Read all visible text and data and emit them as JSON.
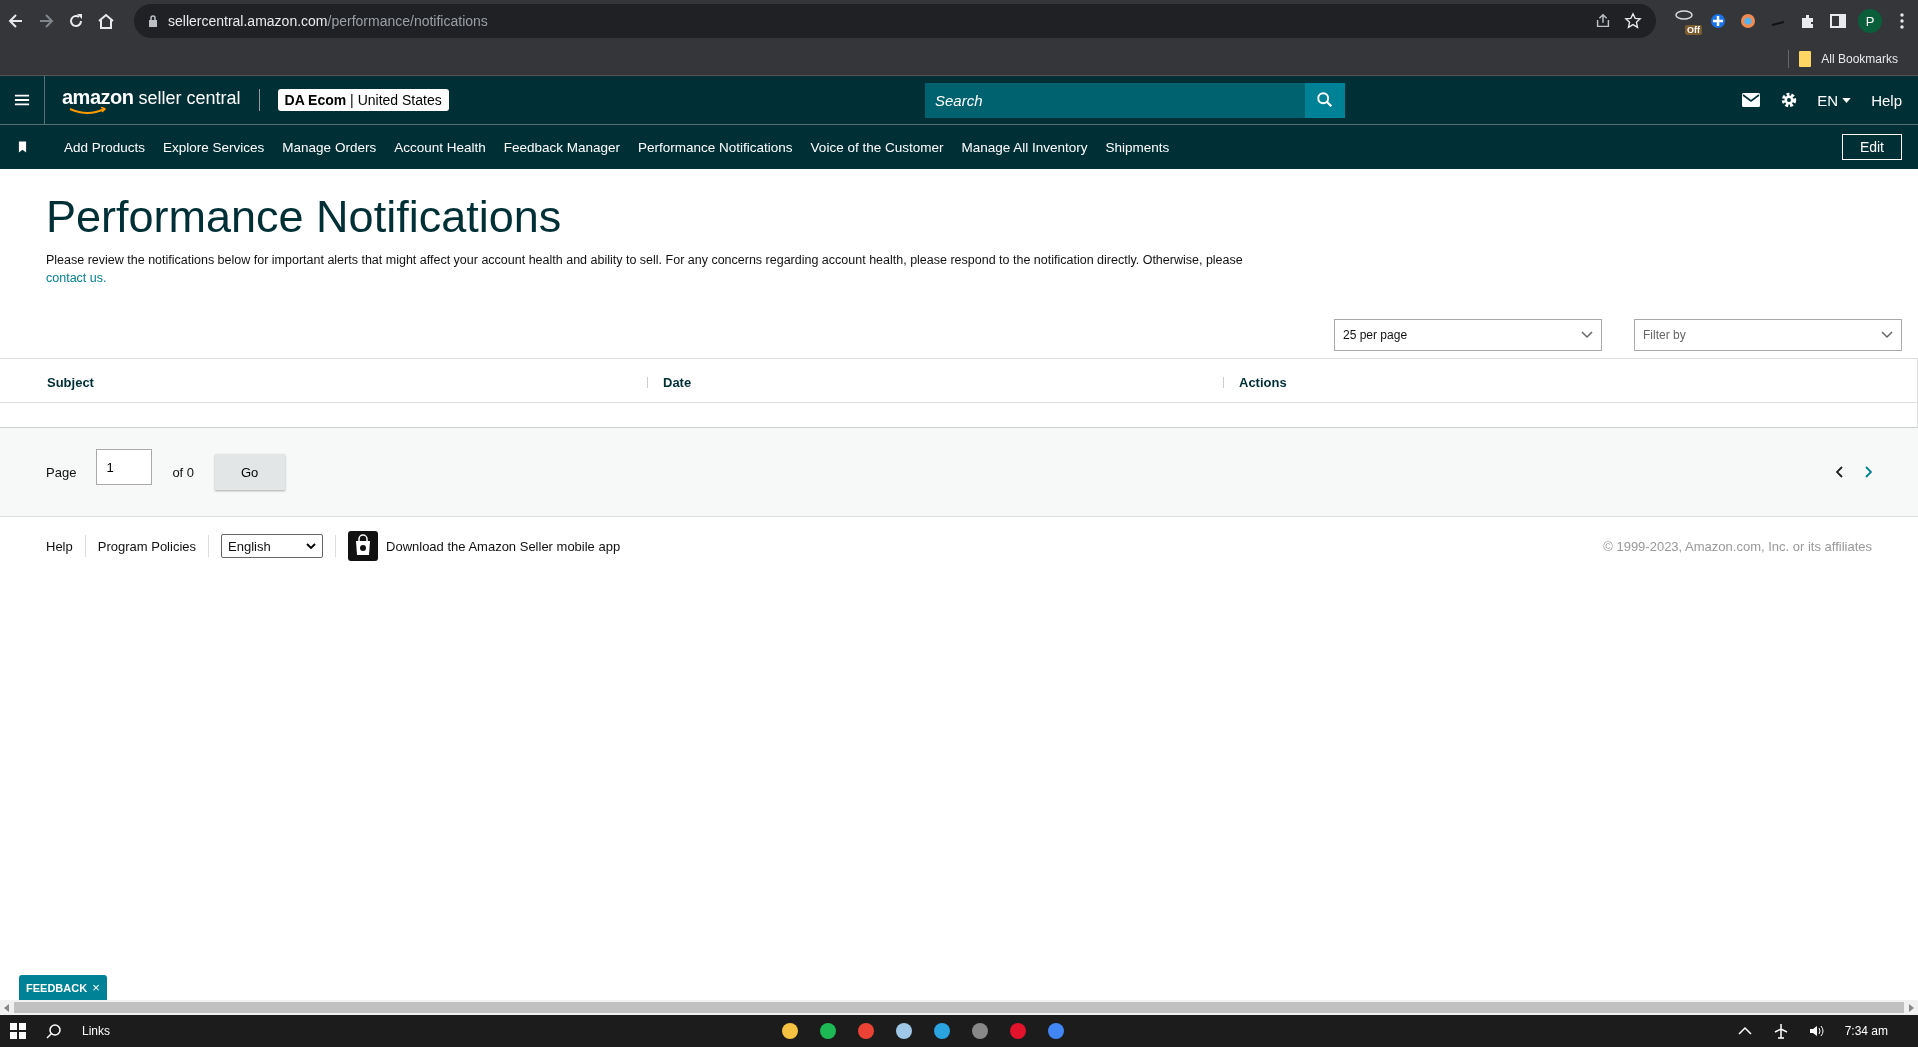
{
  "browser": {
    "url_host": "sellercentral.amazon.com",
    "url_path": "/performance/notifications",
    "extension_badge": "Off",
    "profile": "P",
    "bookmarks": "All Bookmarks"
  },
  "header": {
    "logo_main": "amazon",
    "logo_sub": "seller central",
    "account": "DA Ecom",
    "separator": "|",
    "marketplace": "United States",
    "search": {
      "placeholder": "Search"
    },
    "language": "EN",
    "help": "Help"
  },
  "nav": {
    "items": [
      "Add Products",
      "Explore Services",
      "Manage Orders",
      "Account Health",
      "Feedback Manager",
      "Performance Notifications",
      "Voice of the Customer",
      "Manage All Inventory",
      "Shipments"
    ],
    "edit": "Edit"
  },
  "page": {
    "title": "Performance Notifications",
    "description": "Please review the notifications below for important alerts that might affect your account health and ability to sell. For any concerns regarding account health, please respond to the notification directly. Otherwise, please",
    "link": "contact us.",
    "per_page": "25 per page",
    "filter": {
      "placeholder": "Filter by"
    },
    "table": {
      "columns": [
        "Subject",
        "Date",
        "Actions"
      ]
    },
    "pagination": {
      "label": "Page",
      "value": "1",
      "total": "of 0",
      "go": "Go"
    }
  },
  "footer": {
    "links": [
      "Help",
      "Program Policies"
    ],
    "language": "English",
    "app": "Download the Amazon Seller mobile app",
    "copyright": "© 1999-2023, Amazon.com, Inc. or its affiliates"
  },
  "feedback": {
    "label": "FEEDBACK",
    "close": "×"
  },
  "taskbar": {
    "search": "Links",
    "time": "7:34 am"
  }
}
